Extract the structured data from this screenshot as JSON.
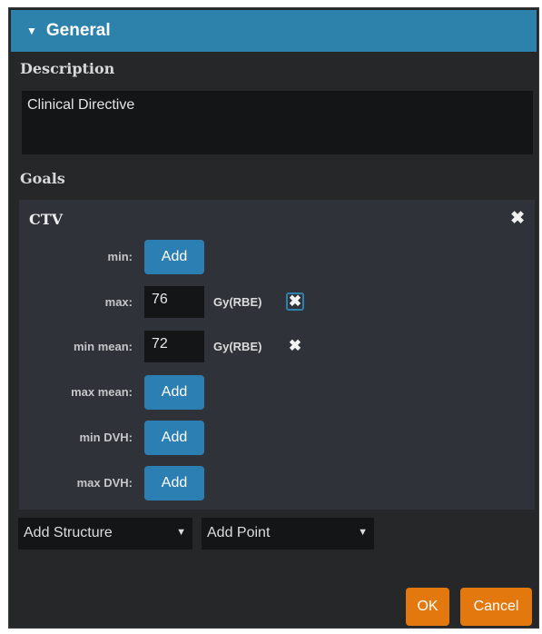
{
  "header": {
    "toggle_icon": "▼",
    "title": "General"
  },
  "description": {
    "label": "Description",
    "value": "Clinical Directive"
  },
  "goals": {
    "label": "Goals",
    "structure": {
      "name": "CTV",
      "remove_icon": "✖",
      "rows": [
        {
          "label": "min:",
          "button": "Add"
        },
        {
          "label": "max:",
          "value": "76",
          "unit": "Gy(RBE)",
          "remove_icon": "✖"
        },
        {
          "label": "min mean:",
          "value": "72",
          "unit": "Gy(RBE)",
          "remove_icon": "✖"
        },
        {
          "label": "max mean:",
          "button": "Add"
        },
        {
          "label": "min DVH:",
          "button": "Add"
        },
        {
          "label": "max DVH:",
          "button": "Add"
        }
      ]
    }
  },
  "add_structure": {
    "label": "Add Structure",
    "caret": "▼"
  },
  "add_point": {
    "label": "Add Point",
    "caret": "▼"
  },
  "footer": {
    "ok": "OK",
    "cancel": "Cancel"
  },
  "colors": {
    "background": "#262729",
    "header": "#2c82ab",
    "add_button": "#2c7fb2",
    "action_button": "#e3780f",
    "input_background": "#141517"
  }
}
